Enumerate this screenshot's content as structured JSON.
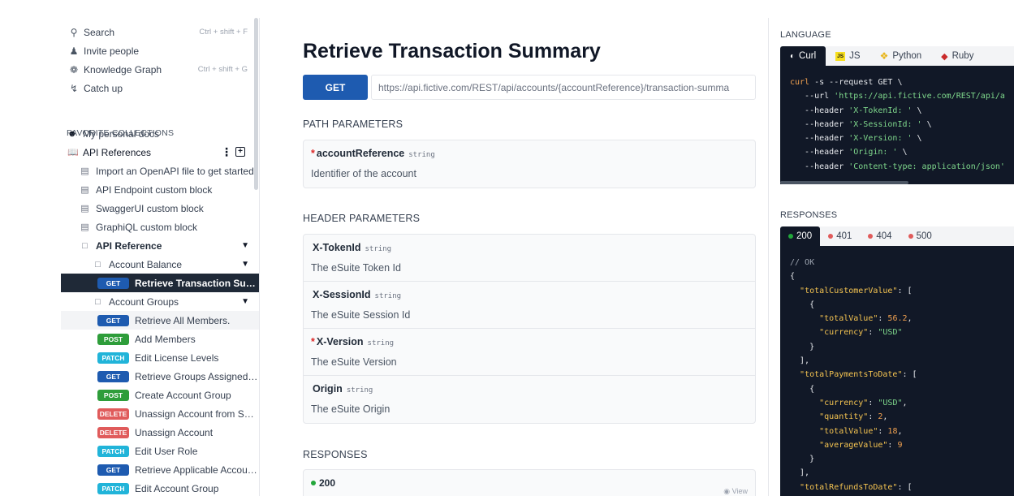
{
  "sidebar": {
    "quick": [
      {
        "icon": "search-icon",
        "label": "Search",
        "shortcut": "Ctrl + shift + F"
      },
      {
        "icon": "invite-icon",
        "label": "Invite people",
        "shortcut": ""
      },
      {
        "icon": "graph-icon",
        "label": "Knowledge Graph",
        "shortcut": "Ctrl + shift + G"
      },
      {
        "icon": "lightning-icon",
        "label": "Catch up",
        "shortcut": ""
      }
    ],
    "favorites_label": "FAVORITE COLLECTIONS",
    "personal_docs": "My personal docs",
    "api_references": "API References",
    "docs": [
      "Import an OpenAPI file to get started",
      "API Endpoint custom block",
      "SwaggerUI custom block",
      "GraphiQL custom block"
    ],
    "api_reference": "API Reference",
    "account_balance": "Account Balance",
    "account_groups": "Account Groups",
    "endpoints_balance": [
      {
        "method": "GET",
        "label": "Retrieve Transaction Summ..."
      }
    ],
    "endpoints_groups": [
      {
        "method": "GET",
        "label": "Retrieve All Members."
      },
      {
        "method": "POST",
        "label": "Add Members"
      },
      {
        "method": "PATCH",
        "label": "Edit License Levels"
      },
      {
        "method": "GET",
        "label": "Retrieve Groups Assigned t..."
      },
      {
        "method": "POST",
        "label": "Create Account Group"
      },
      {
        "method": "DELETE",
        "label": "Unassign Account from Sub..."
      },
      {
        "method": "DELETE",
        "label": "Unassign Account"
      },
      {
        "method": "PATCH",
        "label": "Edit User Role"
      },
      {
        "method": "GET",
        "label": "Retrieve Applicable Accoun..."
      },
      {
        "method": "PATCH",
        "label": "Edit Account Group"
      }
    ]
  },
  "main": {
    "title": "Retrieve Transaction Summary",
    "method": "GET",
    "url": "https://api.fictive.com/REST/api/accounts/{accountReference}/transaction-summa",
    "path_label": "PATH PARAMETERS",
    "path_params": [
      {
        "name": "accountReference",
        "required": "*",
        "type": "string",
        "desc": "Identifier of the account"
      }
    ],
    "header_label": "HEADER PARAMETERS",
    "header_params": [
      {
        "name": "X-TokenId",
        "required": "",
        "type": "string",
        "desc": "The eSuite Token Id"
      },
      {
        "name": "X-SessionId",
        "required": "",
        "type": "string",
        "desc": "The eSuite Session Id"
      },
      {
        "name": "X-Version",
        "required": "*",
        "type": "string",
        "desc": "The eSuite Version"
      },
      {
        "name": "Origin",
        "required": "",
        "type": "string",
        "desc": "The eSuite Origin"
      }
    ],
    "responses_label": "RESPONSES",
    "response_code": "200",
    "view_label": "View"
  },
  "right": {
    "language_label": "LANGUAGE",
    "lang_tabs": [
      "Curl",
      "JS",
      "Python",
      "Ruby"
    ],
    "curl_lines": [
      {
        "a": "curl",
        "b": " -s --request GET \\"
      },
      {
        "a": "   --url ",
        "b": "'https://api.fictive.com/REST/api/a"
      },
      {
        "a": "   --header ",
        "b": "'X-TokenId: '",
        "c": " \\"
      },
      {
        "a": "   --header ",
        "b": "'X-SessionId: '",
        "c": " \\"
      },
      {
        "a": "   --header ",
        "b": "'X-Version: '",
        "c": " \\"
      },
      {
        "a": "   --header ",
        "b": "'Origin: '",
        "c": " \\"
      },
      {
        "a": "   --header ",
        "b": "'Content-type: application/json'"
      }
    ],
    "responses_label": "RESPONSES",
    "resp_tabs": [
      "200",
      "401",
      "404",
      "500"
    ],
    "json_comment": "// OK",
    "json": {
      "k_total_customer": "\"totalCustomerValue\"",
      "k_total_value": "\"totalValue\"",
      "v_total_value": "56.2",
      "k_currency": "\"currency\"",
      "v_currency": "\"USD\"",
      "k_total_payments": "\"totalPaymentsToDate\"",
      "k_quantity": "\"quantity\"",
      "v_quantity": "2",
      "v_total_value2": "18",
      "k_average": "\"averageValue\"",
      "v_average": "9",
      "k_total_refunds": "\"totalRefundsToDate\""
    }
  }
}
